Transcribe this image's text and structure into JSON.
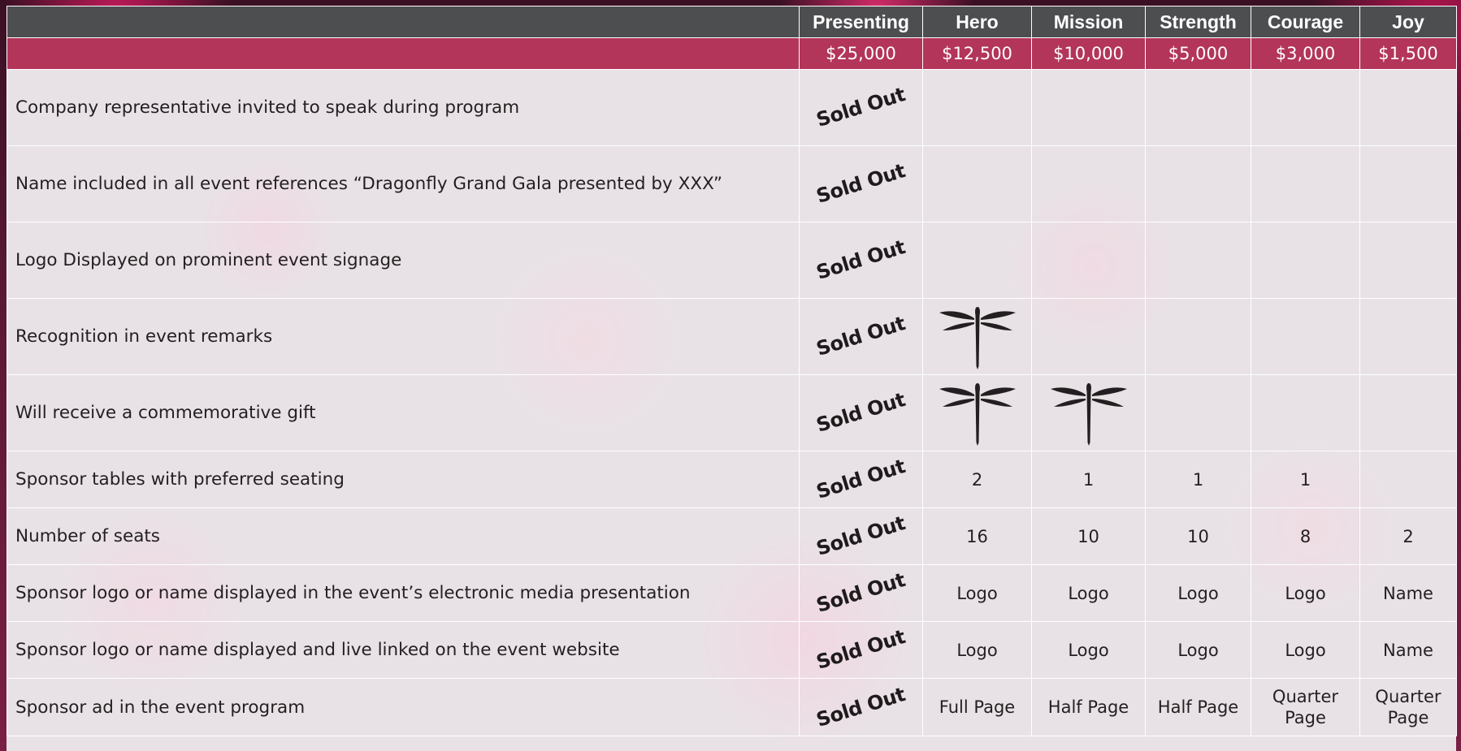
{
  "header": {
    "columns": [
      "Presenting",
      "Hero",
      "Mission",
      "Strength",
      "Courage",
      "Joy"
    ],
    "prices": [
      "$25,000",
      "$12,500",
      "$10,000",
      "$5,000",
      "$3,000",
      "$1,500"
    ]
  },
  "sold_out_label": "Sold Out",
  "rows": [
    {
      "label": "Company representative invited to speak during program",
      "cells": [
        "",
        "",
        "",
        "",
        ""
      ]
    },
    {
      "label": "Name included in all event references “Dragonfly Grand Gala presented by XXX”",
      "cells": [
        "",
        "",
        "",
        "",
        ""
      ]
    },
    {
      "label": "Logo Displayed on prominent event signage",
      "cells": [
        "",
        "",
        "",
        "",
        ""
      ]
    },
    {
      "label": "Recognition in event remarks",
      "cells": [
        "dragonfly-icon",
        "",
        "",
        "",
        ""
      ]
    },
    {
      "label": "Will receive a commemorative gift",
      "cells": [
        "dragonfly-icon",
        "dragonfly-icon",
        "",
        "",
        ""
      ]
    },
    {
      "label": "Sponsor tables with preferred seating",
      "cells": [
        "2",
        "1",
        "1",
        "1",
        ""
      ]
    },
    {
      "label": "Number of seats",
      "cells": [
        "16",
        "10",
        "10",
        "8",
        "2"
      ]
    },
    {
      "label": "Sponsor logo or name displayed in the event’s electronic media presentation",
      "cells": [
        "Logo",
        "Logo",
        "Logo",
        "Logo",
        "Name"
      ]
    },
    {
      "label": "Sponsor logo or name displayed and live linked on the event website",
      "cells": [
        "Logo",
        "Logo",
        "Logo",
        "Logo",
        "Name"
      ]
    },
    {
      "label": "Sponsor ad in the event program",
      "cells": [
        "Full Page",
        "Half Page",
        "Half Page",
        "Quarter Page",
        "Quarter Page"
      ]
    }
  ],
  "colors": {
    "header_bg": "#4d4e50",
    "price_bg": "#b3355a",
    "text": "#231f20"
  }
}
